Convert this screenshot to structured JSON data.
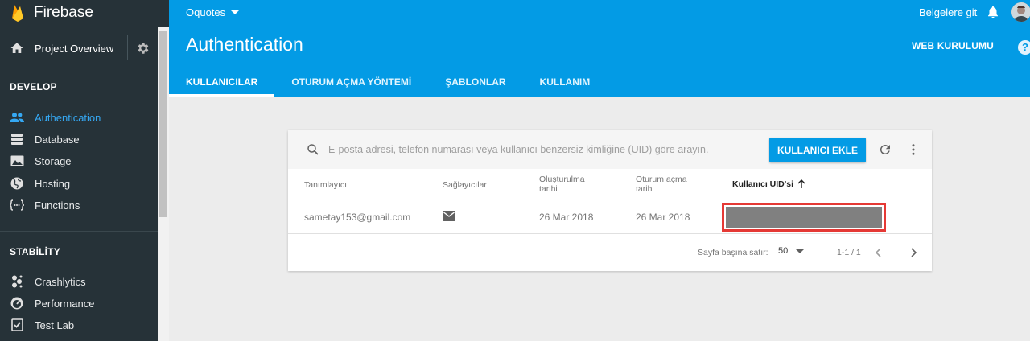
{
  "sidebar": {
    "brand": "Firebase",
    "project_overview": "Project Overview",
    "sections": [
      {
        "title": "DEVELOP",
        "items": [
          "Authentication",
          "Database",
          "Storage",
          "Hosting",
          "Functions"
        ]
      },
      {
        "title": "STABİLİTY",
        "items": [
          "Crashlytics",
          "Performance",
          "Test Lab"
        ]
      }
    ]
  },
  "header": {
    "project": "Oquotes",
    "docs_link": "Belgelere git",
    "page_title": "Authentication",
    "web_setup": "WEB KURULUMU",
    "help": "?",
    "tabs": [
      "KULLANICILAR",
      "OTURUM AÇMA YÖNTEMİ",
      "ŞABLONLAR",
      "KULLANIM"
    ]
  },
  "users": {
    "search_placeholder": "E-posta adresi, telefon numarası veya kullanıcı benzersiz kimliğine (UID) göre arayın.",
    "add_user": "KULLANICI EKLE",
    "columns": {
      "identifier": "Tanımlayıcı",
      "providers": "Sağlayıcılar",
      "created_1": "Oluşturulma",
      "created_2": "tarihi",
      "signin_1": "Oturum açma",
      "signin_2": "tarihi",
      "uid": "Kullanıcı UID'si"
    },
    "rows": [
      {
        "identifier": "sametay153@gmail.com",
        "provider_icon": "email-icon",
        "created": "26 Mar 2018",
        "signed_in": "26 Mar 2018"
      }
    ],
    "footer": {
      "rows_per_page_label": "Sayfa başına satır:",
      "rows_per_page": "50",
      "range": "1-1 / 1"
    }
  },
  "colors": {
    "header": "#039be5",
    "sidebar": "#263238",
    "active": "#35a8f3",
    "highlight": "#e53935"
  }
}
